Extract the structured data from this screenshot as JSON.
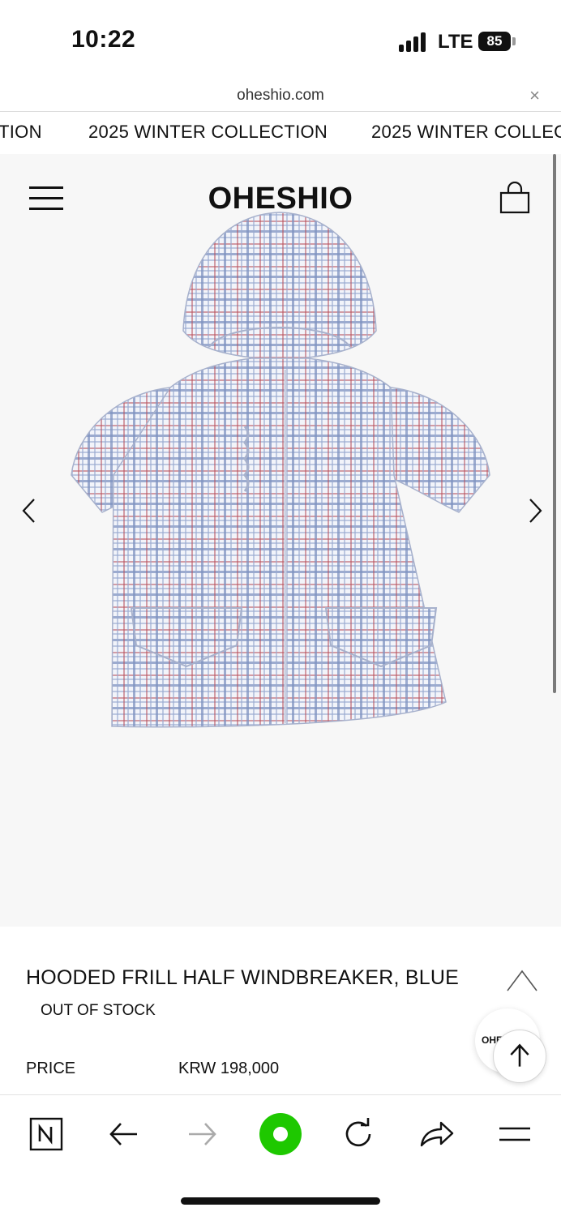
{
  "status_bar": {
    "time": "10:22",
    "network": "LTE",
    "battery": "85"
  },
  "browser": {
    "url": "oheshio.com",
    "close_symbol": "×"
  },
  "marquee": {
    "items": [
      "TION",
      "2025 WINTER COLLECTION",
      "2025 WINTER COLLEC"
    ]
  },
  "header": {
    "logo": "OHESHIO"
  },
  "product": {
    "title": "HOODED FRILL HALF WINDBREAKER, BLUE",
    "stock_status": "OUT OF STOCK",
    "price_label": "PRICE",
    "price_value": "KRW 198,000"
  },
  "chat": {
    "label": "OHESHIO"
  },
  "icons": {
    "menu": "hamburger-menu-icon",
    "bag": "shopping-bag-icon",
    "prev": "chevron-left-icon",
    "next": "chevron-right-icon",
    "collapse": "chevron-up-icon",
    "scroll_top": "arrow-up-icon"
  },
  "toolbar": {
    "items": [
      "naver-home-icon",
      "back-arrow-icon",
      "forward-arrow-icon",
      "green-search-icon",
      "reload-icon",
      "share-icon",
      "menu-icon"
    ]
  },
  "colors": {
    "accent_green": "#1ec800",
    "plaid_blue": "#7f93c0",
    "plaid_red": "#b9545e",
    "hero_bg": "#f7f7f7"
  }
}
